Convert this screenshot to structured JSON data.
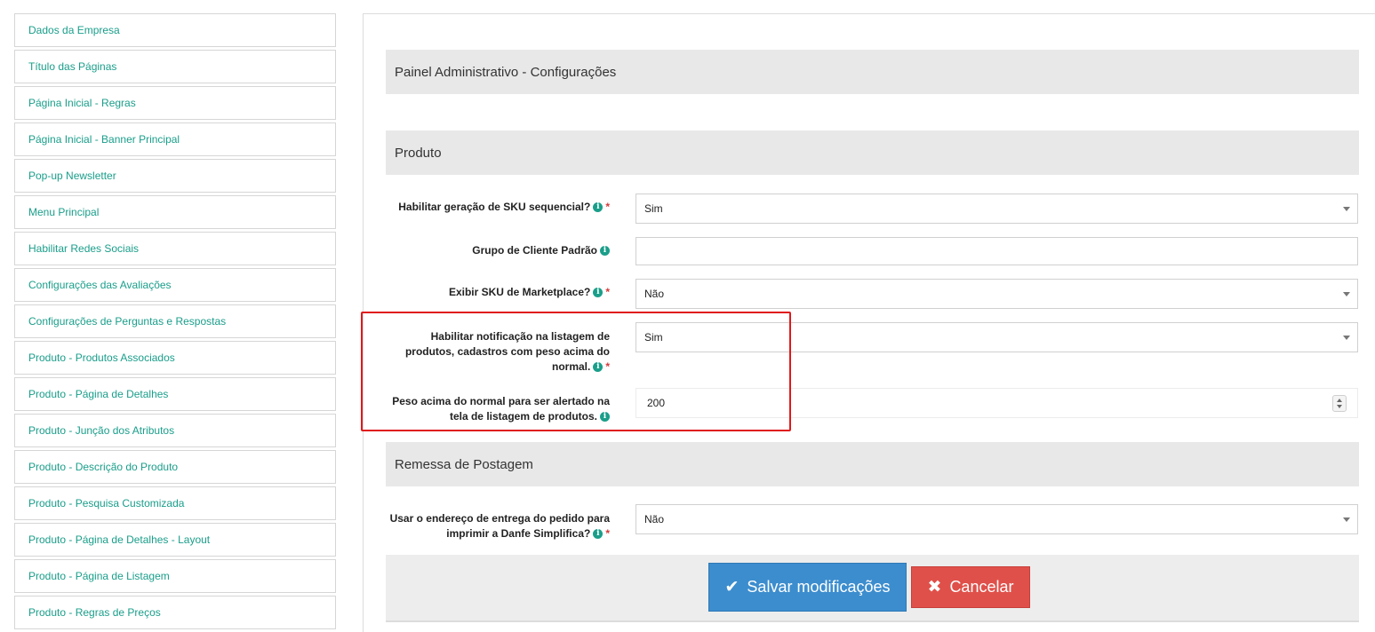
{
  "sidebar": {
    "items": [
      {
        "label": "Dados da Empresa"
      },
      {
        "label": "Título das Páginas"
      },
      {
        "label": "Página Inicial - Regras"
      },
      {
        "label": "Página Inicial - Banner Principal"
      },
      {
        "label": "Pop-up Newsletter"
      },
      {
        "label": "Menu Principal"
      },
      {
        "label": "Habilitar Redes Sociais"
      },
      {
        "label": "Configurações das Avaliações"
      },
      {
        "label": "Configurações de Perguntas e Respostas"
      },
      {
        "label": "Produto - Produtos Associados"
      },
      {
        "label": "Produto - Página de Detalhes"
      },
      {
        "label": "Produto - Junção dos Atributos"
      },
      {
        "label": "Produto - Descrição do Produto"
      },
      {
        "label": "Produto - Pesquisa Customizada"
      },
      {
        "label": "Produto - Página de Detalhes - Layout"
      },
      {
        "label": "Produto - Página de Listagem"
      },
      {
        "label": "Produto - Regras de Preços"
      }
    ]
  },
  "main": {
    "page_header": "Painel Administrativo - Configurações",
    "section_produto": "Produto",
    "fields": {
      "sku_sequencial": {
        "label": "Habilitar geração de SKU sequencial?",
        "value": "Sim"
      },
      "grupo_cliente": {
        "label": "Grupo de Cliente Padrão",
        "value": ""
      },
      "sku_marketplace": {
        "label": "Exibir SKU de Marketplace?",
        "value": "Não"
      },
      "notificacao_peso": {
        "label_line1": "Habilitar notificação na listagem de",
        "label_line2": "produtos, cadastros com peso acima do",
        "label_line3": "normal.",
        "value": "Sim"
      },
      "peso_acima": {
        "label_line1": "Peso acima do normal para ser alertado na",
        "label_line2": "tela de listagem de produtos.",
        "value": "200"
      }
    },
    "section_remessa": "Remessa de Postagem",
    "remessa_fields": {
      "endereco_entrega": {
        "label_line1": "Usar o endereço de entrega do pedido para",
        "label_line2": "imprimir a Danfe Simplifica?",
        "value": "Não"
      }
    },
    "required_mark": "*",
    "info_glyph": "i"
  },
  "buttons": {
    "save": {
      "label": "Salvar modificações",
      "icon": "checkmark-icon",
      "glyph": "✔"
    },
    "cancel": {
      "label": "Cancelar",
      "icon": "close-icon",
      "glyph": "✖"
    }
  },
  "colors": {
    "accent": "#1a9e8a",
    "primary": "#3c8dce",
    "danger": "#e0504a",
    "highlight": "#e0181b"
  }
}
